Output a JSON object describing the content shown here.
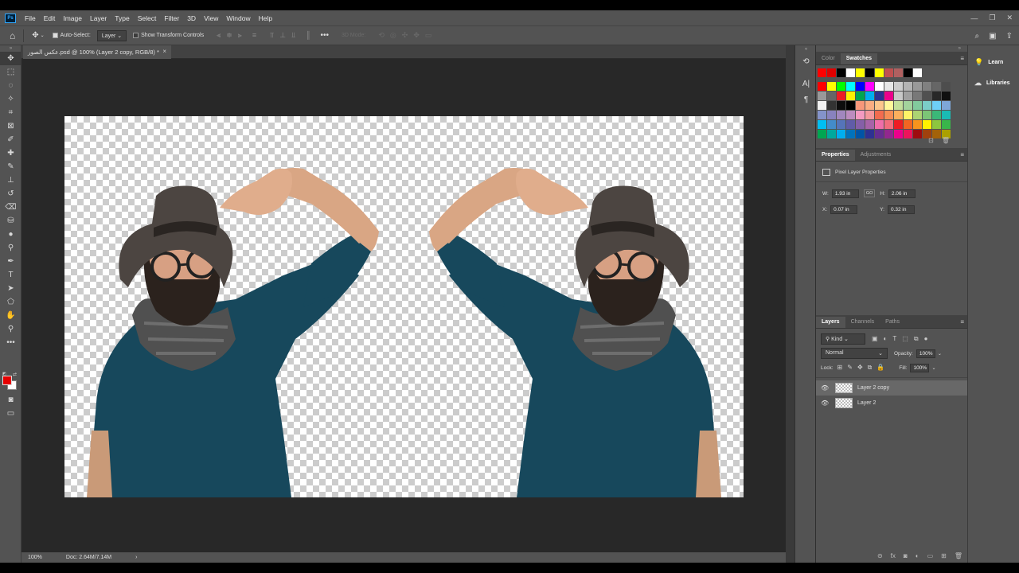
{
  "menubar": {
    "logo": "Ps",
    "items": [
      "File",
      "Edit",
      "Image",
      "Layer",
      "Type",
      "Select",
      "Filter",
      "3D",
      "View",
      "Window",
      "Help"
    ]
  },
  "options": {
    "auto_select_label": "Auto-Select:",
    "auto_select_value": "Layer",
    "show_transform_label": "Show Transform Controls",
    "mode_3d_label": "3D Mode:"
  },
  "document": {
    "tab_title": "عكس الصور.psd @ 100% (Layer 2 copy, RGB/8) *",
    "close": "×"
  },
  "status": {
    "zoom": "100%",
    "doc": "Doc: 2.64M/7.14M",
    "arrow": "›"
  },
  "color_panel": {
    "tabs": [
      "Color",
      "Swatches"
    ],
    "active": "Swatches",
    "recent": [
      "#ff0000",
      "#e00000",
      "#000000",
      "#ffffff",
      "#ffff00",
      "#000000",
      "#ffff00",
      "#c05050",
      "#b06060",
      "#000000",
      "#ffffff"
    ],
    "grid": [
      [
        "#ff0000",
        "#ffff00",
        "#00ff00",
        "#00ffff",
        "#0000ff",
        "#ff00ff",
        "#ffffff",
        "#e6e6e6",
        "#cccccc",
        "#b3b3b3",
        "#999999",
        "#808080",
        "#666666",
        "#4d4d4d"
      ],
      [
        "#999999",
        "#666666",
        "#ed1c24",
        "#fff200",
        "#00a651",
        "#00aeef",
        "#2e3192",
        "#ec008c",
        "#c8c8c8",
        "#a0a0a0",
        "#787878",
        "#505050",
        "#282828",
        "#101010"
      ],
      [
        "#f2f2f2",
        "#333333",
        "#0d0d0d",
        "#000000",
        "#f7977a",
        "#fbad82",
        "#fdc68c",
        "#fff79a",
        "#c4df9b",
        "#a3d39c",
        "#82ca9d",
        "#7bcdc8",
        "#6ecff6",
        "#7ea7d8"
      ],
      [
        "#8493ca",
        "#8882be",
        "#a187be",
        "#bc8cbf",
        "#f49ac1",
        "#f5989d",
        "#f26c4f",
        "#f68e56",
        "#fbaf5d",
        "#fff467",
        "#acd372",
        "#7cc576",
        "#3bb878",
        "#1abbb4"
      ],
      [
        "#00bff3",
        "#438cca",
        "#5574b9",
        "#605ca8",
        "#855fa8",
        "#a763a8",
        "#f06ea9",
        "#f26d7d",
        "#ed1c24",
        "#f26522",
        "#f7941d",
        "#fff200",
        "#8dc63f",
        "#39b54a"
      ],
      [
        "#00a651",
        "#00a99d",
        "#00aeef",
        "#0072bc",
        "#0054a6",
        "#2e3192",
        "#662d91",
        "#92278f",
        "#ec008c",
        "#ed145b",
        "#9e0b0f",
        "#a0410d",
        "#a36209",
        "#aba000"
      ]
    ]
  },
  "properties": {
    "tabs": [
      "Properties",
      "Adjustments"
    ],
    "title": "Pixel Layer Properties",
    "w_label": "W:",
    "w": "1.93 in",
    "link": "GO",
    "h_label": "H:",
    "h": "2.06 in",
    "x_label": "X:",
    "x": "0.07 in",
    "y_label": "Y:",
    "y": "0.32 in"
  },
  "layers": {
    "tabs": [
      "Layers",
      "Channels",
      "Paths"
    ],
    "kind": "Kind",
    "blend_mode": "Normal",
    "opacity_label": "Opacity:",
    "opacity": "100%",
    "lock_label": "Lock:",
    "fill_label": "Fill:",
    "fill": "100%",
    "items": [
      {
        "name": "Layer 2 copy",
        "selected": true
      },
      {
        "name": "Layer 2",
        "selected": false
      }
    ]
  },
  "learn": {
    "items": [
      "Learn",
      "Libraries"
    ]
  }
}
